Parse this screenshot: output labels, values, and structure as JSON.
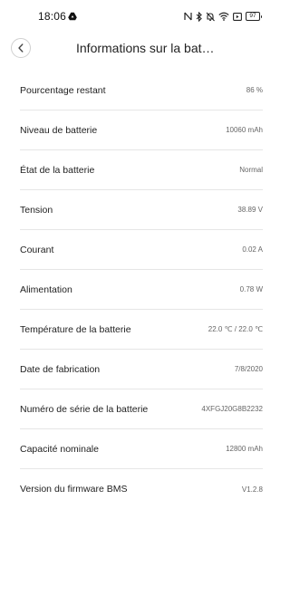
{
  "status_bar": {
    "time": "18:06",
    "battery_level": "97"
  },
  "header": {
    "title": "Informations sur la bat…"
  },
  "rows": [
    {
      "label": "Pourcentage restant",
      "value": "86 %"
    },
    {
      "label": "Niveau de batterie",
      "value": "10060 mAh"
    },
    {
      "label": "État de la batterie",
      "value": "Normal"
    },
    {
      "label": "Tension",
      "value": "38.89 V"
    },
    {
      "label": "Courant",
      "value": "0.02 A"
    },
    {
      "label": "Alimentation",
      "value": "0.78 W"
    },
    {
      "label": "Température de la batterie",
      "value": "22.0 ℃ / 22.0 ℃"
    },
    {
      "label": "Date de fabrication",
      "value": "7/8/2020"
    },
    {
      "label": "Numéro de série de la batterie",
      "value": "4XFGJ20G8B2232"
    },
    {
      "label": "Capacité nominale",
      "value": "12800 mAh"
    },
    {
      "label": "Version du firmware BMS",
      "value": "V1.2.8"
    }
  ],
  "icons": {
    "back": "chevron-left-icon",
    "status": [
      "google-drive-icon",
      "nfc-icon",
      "bluetooth-icon",
      "mute-icon",
      "wifi-icon",
      "cast-icon",
      "battery-icon"
    ]
  }
}
